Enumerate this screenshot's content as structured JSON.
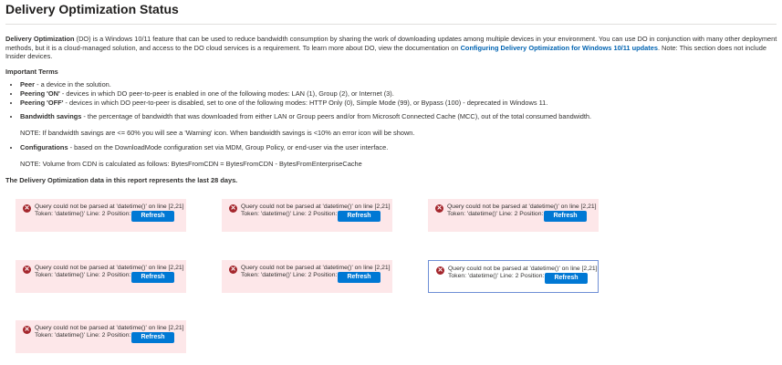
{
  "page": {
    "title": "Delivery Optimization Status"
  },
  "intro": {
    "lead_bold": "Delivery Optimization",
    "text1": " (DO) is a Windows 10/11 feature that can be used to reduce bandwidth consumption by sharing the work of downloading updates among multiple devices in your environment. You can use DO in conjunction with many other deployment methods, but it is a cloud-managed solution, and access to the DO cloud services is a requirement. To learn more about DO, view the documentation on ",
    "link": "Configuring Delivery Optimization for Windows 10/11 updates",
    "text2": ". Note: This section does not include Insider devices."
  },
  "terms": {
    "heading": "Important Terms",
    "peer_label": "Peer",
    "peer_text": " - a device in the solution.",
    "on_label": "Peering 'ON'",
    "on_text": " - devices in which DO peer-to-peer is enabled in one of the following modes: LAN (1), Group (2), or Internet (3).",
    "off_label": "Peering 'OFF'",
    "off_text": " - devices in which DO peer-to-peer is disabled, set to one of the following modes: HTTP Only (0), Simple Mode (99), or Bypass (100) - deprecated in Windows 11.",
    "bw_label": "Bandwidth savings",
    "bw_text": " - the percentage of bandwidth that was downloaded from either LAN or Group peers and/or from Microsoft Connected Cache (MCC), out of the total consumed bandwidth.",
    "bw_note": "NOTE: If bandwidth savings are <= 60% you will see a 'Warning' icon. When bandwidth savings is <10% an error icon will be shown.",
    "cfg_label": "Configurations",
    "cfg_text": " - based on the DownloadMode configuration set via MDM, Group Policy, or end-user via the user interface.",
    "cfg_note": "NOTE: Volume from CDN is calculated as follows: BytesFromCDN = BytesFromCDN - BytesFromEnterpriseCache"
  },
  "data_note": "The Delivery Optimization data in this report represents the last 28 days.",
  "error": {
    "line1": "Query could not be parsed at 'datetime()' on line [2,21]",
    "line2": "Token: 'datetime()' Line: 2 Position: 21",
    "button": "Refresh",
    "icon": "error-circle-icon",
    "color": "#a4262c"
  },
  "colors": {
    "accent": "#0078d4",
    "error_bg": "#fde7e9",
    "link": "#0063b1"
  }
}
